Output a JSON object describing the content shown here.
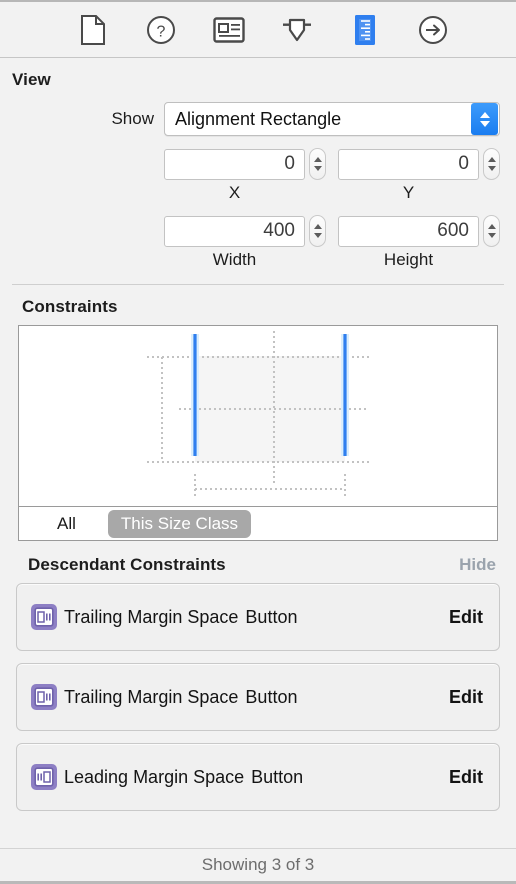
{
  "toolbar": {
    "items": [
      {
        "name": "file-inspector-icon",
        "label": "File Inspector",
        "selected": false
      },
      {
        "name": "quick-help-icon",
        "label": "Quick Help Inspector",
        "selected": false
      },
      {
        "name": "identity-inspector-icon",
        "label": "Identity Inspector",
        "selected": false
      },
      {
        "name": "attributes-inspector-icon",
        "label": "Attributes Inspector",
        "selected": false
      },
      {
        "name": "size-inspector-icon",
        "label": "Size Inspector",
        "selected": true
      },
      {
        "name": "connections-inspector-icon",
        "label": "Connections Inspector",
        "selected": false
      }
    ],
    "selected_color": "#2f7fef"
  },
  "view": {
    "title": "View",
    "show_label": "Show",
    "show_value": "Alignment Rectangle",
    "fields": [
      {
        "value": "0",
        "caption": "X"
      },
      {
        "value": "0",
        "caption": "Y"
      },
      {
        "value": "400",
        "caption": "Width"
      },
      {
        "value": "600",
        "caption": "Height"
      }
    ]
  },
  "constraints": {
    "title": "Constraints",
    "scope_options": [
      {
        "label": "All",
        "selected": false
      },
      {
        "label": "This Size Class",
        "selected": true
      }
    ],
    "diagram": {
      "edge_color": "#2f7fef",
      "guide_color": "#bdbdbd",
      "fill_color": "#f4f4f4"
    }
  },
  "descendants": {
    "title": "Descendant Constraints",
    "hide_label": "Hide",
    "rows": [
      {
        "icon": "constraint-trailing-icon",
        "relation": "Trailing Margin Space",
        "object": "Button",
        "edit_label": "Edit"
      },
      {
        "icon": "constraint-trailing-icon",
        "relation": "Trailing Margin Space",
        "object": "Button",
        "edit_label": "Edit"
      },
      {
        "icon": "constraint-leading-icon",
        "relation": "Leading Margin Space",
        "object": "Button",
        "edit_label": "Edit"
      }
    ]
  },
  "footer": {
    "status": "Showing 3 of 3"
  }
}
